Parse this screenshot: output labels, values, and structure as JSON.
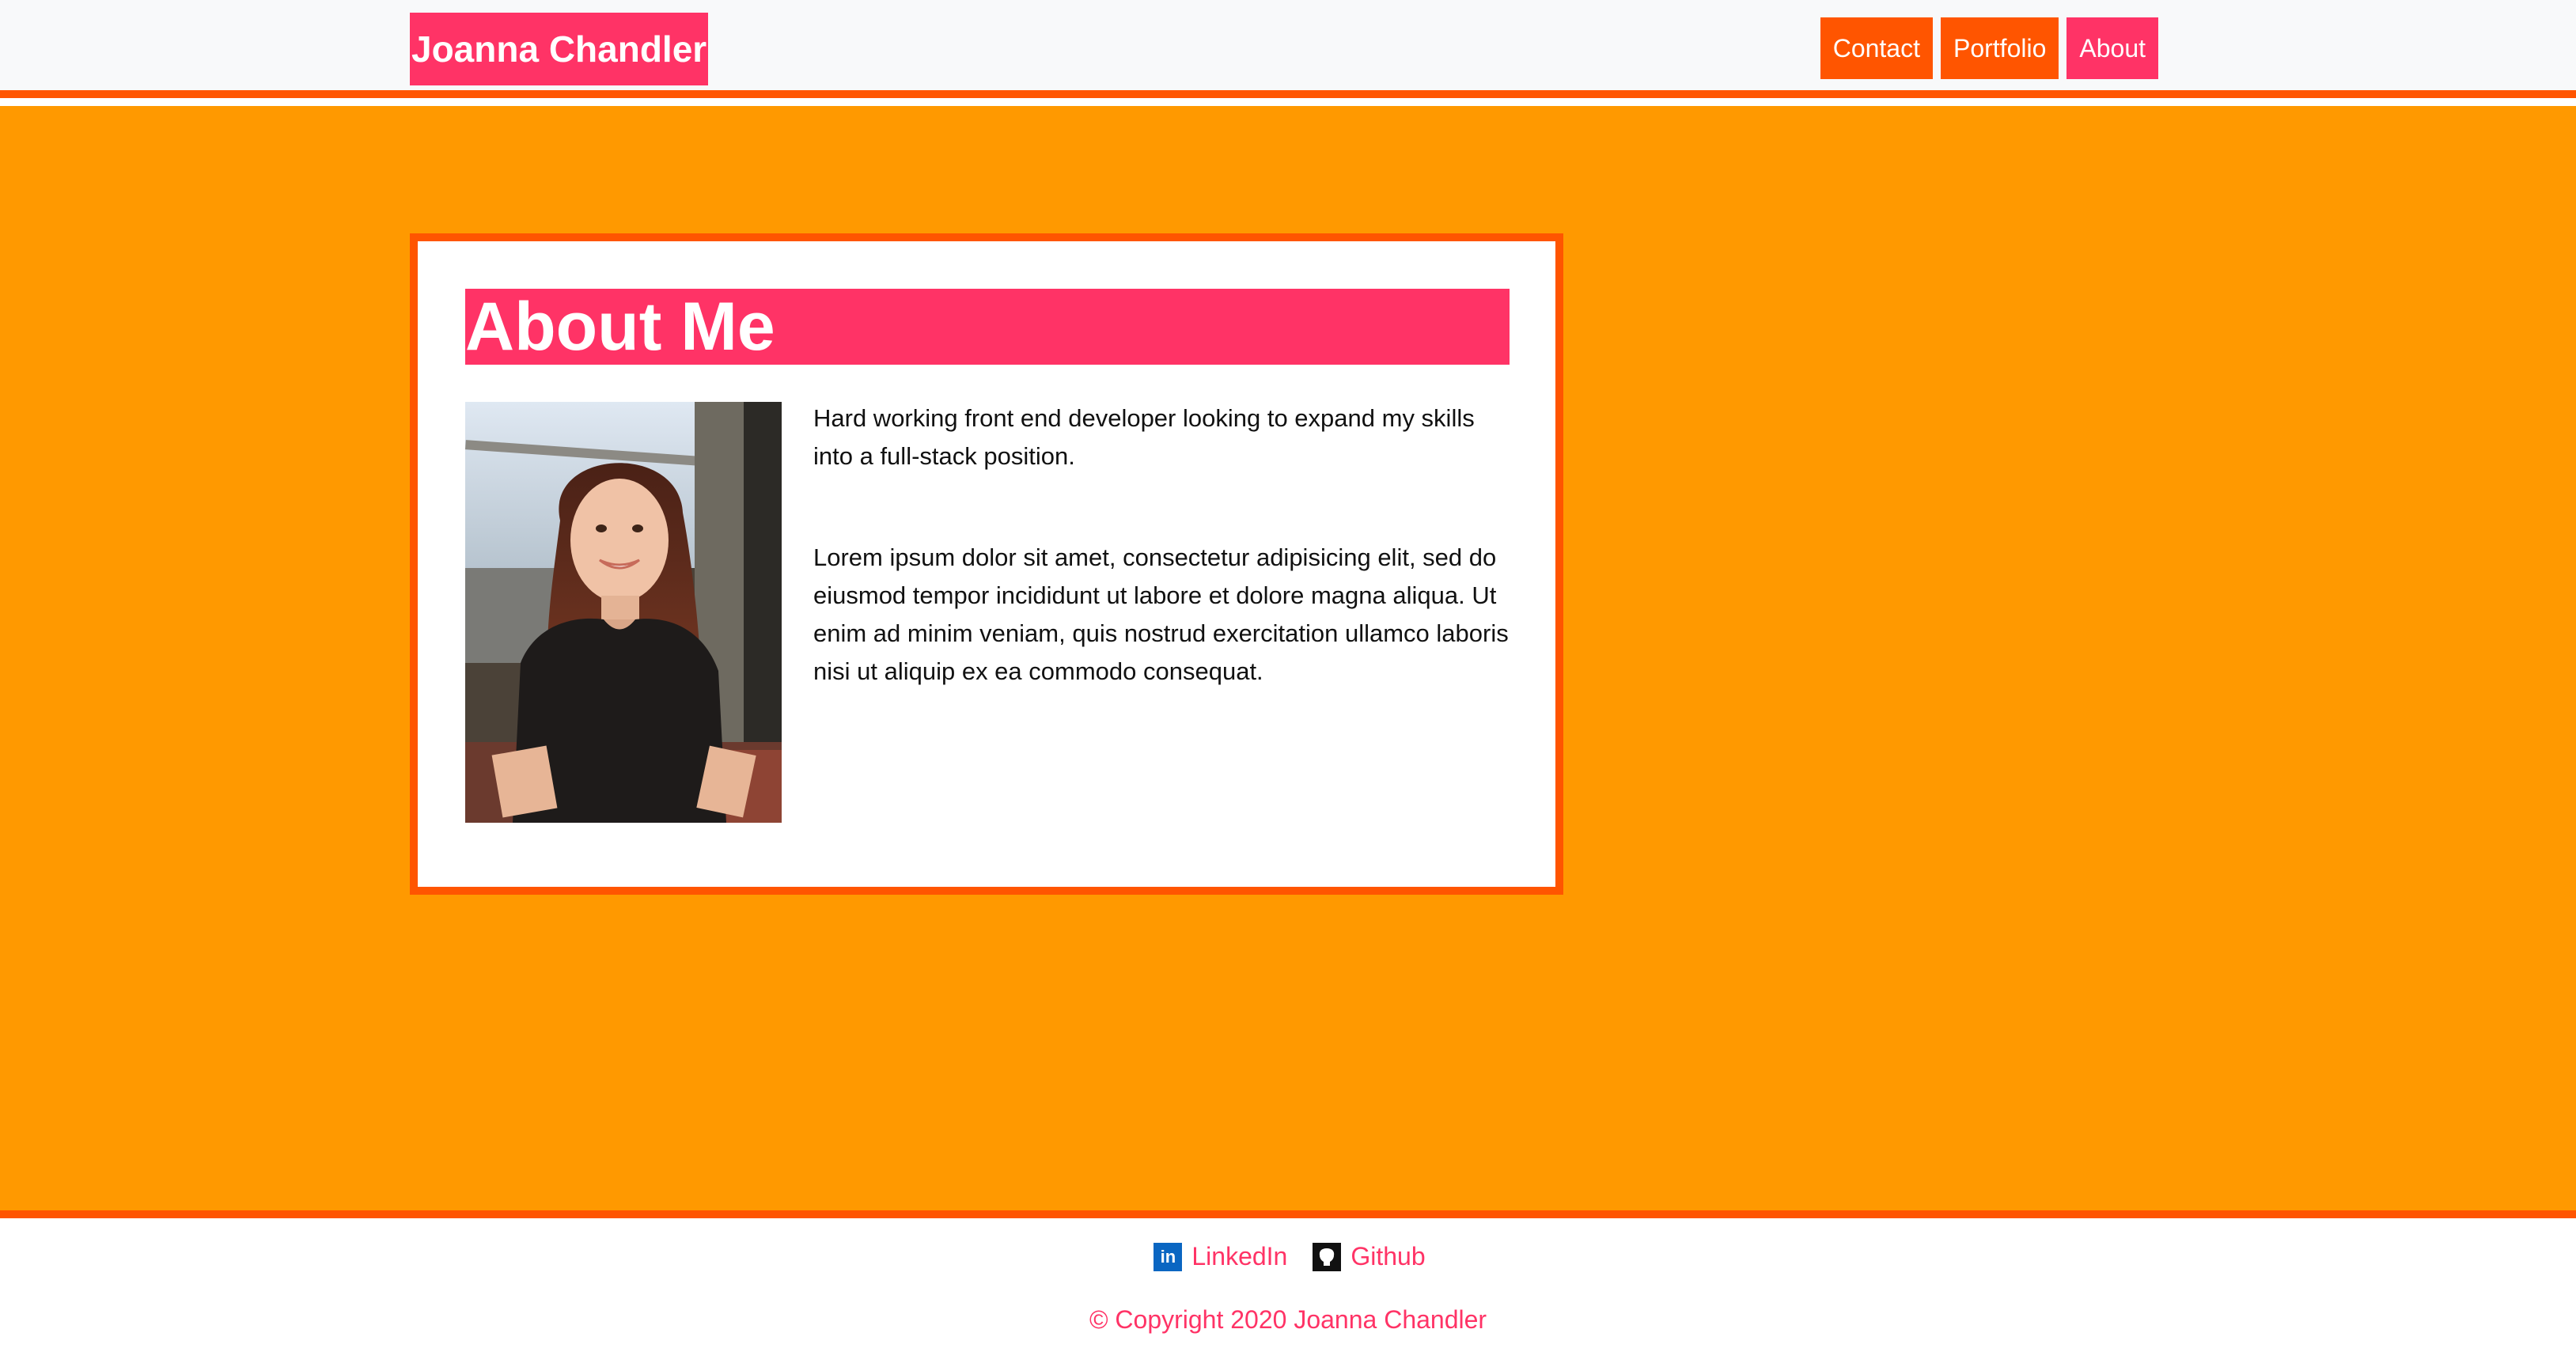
{
  "brand": {
    "name": "Joanna Chandler"
  },
  "nav": {
    "items": [
      {
        "label": "Contact",
        "active": false
      },
      {
        "label": "Portfolio",
        "active": false
      },
      {
        "label": "About",
        "active": true
      }
    ]
  },
  "about": {
    "title": "About Me",
    "paragraphs": [
      "Hard working front end developer looking to expand my skills into a full-stack position.",
      "Lorem ipsum dolor sit amet, consectetur adipisicing elit, sed do eiusmod tempor incididunt ut labore et dolore magna aliqua. Ut enim ad minim veniam, quis nostrud exercitation ullamco laboris nisi ut aliquip ex ea commodo consequat."
    ],
    "photo_icon": "portrait-photo"
  },
  "footer": {
    "links": [
      {
        "label": "LinkedIn",
        "icon": "linkedin-icon"
      },
      {
        "label": "Github",
        "icon": "github-icon"
      }
    ],
    "copyright": "© Copyright 2020 Joanna Chandler"
  },
  "colors": {
    "accent_pink": "#ff3366",
    "accent_orange": "#ff5500",
    "background_orange": "#ff9900",
    "header_bg": "#f8f9fa"
  }
}
